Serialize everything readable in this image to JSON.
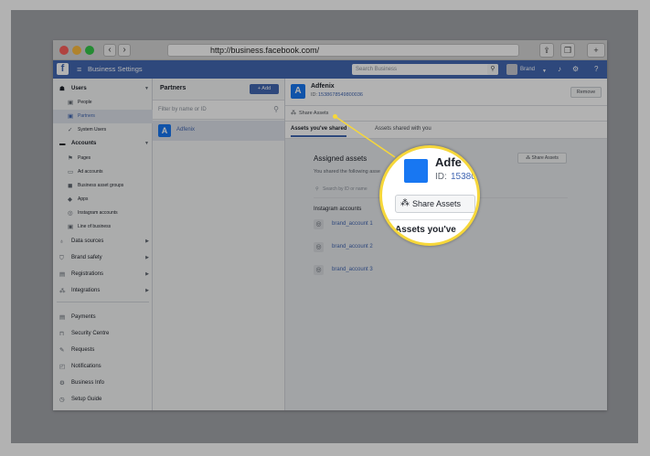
{
  "browser": {
    "url": "http://business.facebook.com/",
    "back": "‹",
    "forward": "›"
  },
  "topbar": {
    "logo": "f",
    "title": "Business Settings",
    "search_placeholder": "Search Business",
    "account_name": "Brand"
  },
  "sidebar": {
    "users_header": "Users",
    "users_items": [
      "People",
      "Partners",
      "System Users"
    ],
    "accounts_header": "Accounts",
    "accounts_items": [
      "Pages",
      "Ad accounts",
      "Business asset groups",
      "Apps",
      "Instagram accounts",
      "Line of business"
    ],
    "sections": [
      "Data sources",
      "Brand safety",
      "Registrations",
      "Integrations"
    ],
    "bottom_items": [
      "Payments",
      "Security Centre",
      "Requests",
      "Notifications",
      "Business Info",
      "Setup Guide"
    ]
  },
  "partners": {
    "title": "Partners",
    "add_label": "+ Add",
    "filter_placeholder": "Filter by name or ID",
    "selected": {
      "initial": "A",
      "name": "Adfenix"
    }
  },
  "detail": {
    "name": "Adfenix",
    "id_label": "ID:",
    "id_value": "1538678549800036",
    "remove_label": "Remove",
    "share_link": "Share Assets",
    "tabs": [
      "Assets you've shared",
      "Assets shared with you"
    ],
    "assigned_title": "Assigned assets",
    "assigned_desc": "You shared the following asse",
    "share_button": "Share Assets",
    "search_placeholder": "Search by ID or name",
    "section_label": "Instagram accounts",
    "accounts": [
      "brand_account 1",
      "brand_account 2",
      "brand_account 3"
    ]
  },
  "magnifier": {
    "name": "Adfe",
    "id_label": "ID:",
    "id_value": "15380",
    "button_label": "Share Assets",
    "tab_label": "Assets you've"
  },
  "colors": {
    "fb_blue": "#4267b2",
    "link_blue": "#4267b2",
    "highlight": "#f6d73a"
  }
}
